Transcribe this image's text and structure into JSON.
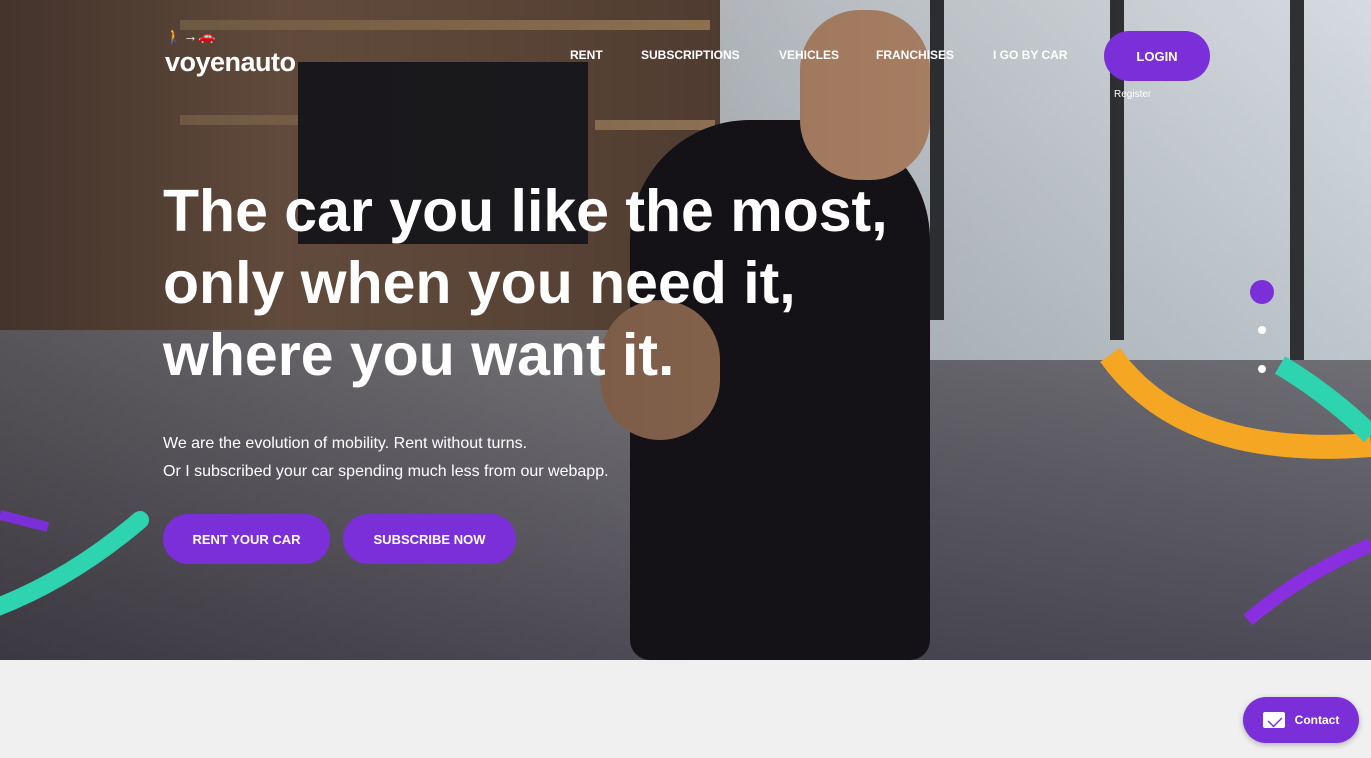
{
  "brand": {
    "logo_mark": "🚶→🚗",
    "name": "voyenauto"
  },
  "nav": {
    "items": [
      "RENT",
      "SUBSCRIPTIONS",
      "VEHICLES",
      "FRANCHISES",
      "I GO BY CAR"
    ],
    "login_label": "LOGIN",
    "register_label": "Register"
  },
  "hero": {
    "headline": [
      "The car you like the most,",
      "only when you need it,",
      "where you want it."
    ],
    "subtext": [
      "We are the evolution of mobility. Rent without turns.",
      "Or I subscribed your car spending much less from our webapp."
    ],
    "cta_rent": "RENT YOUR CAR",
    "cta_subscribe": "SUBSCRIBE NOW"
  },
  "carousel": {
    "active_index": 0,
    "count": 3
  },
  "contact": {
    "label": "Contact",
    "icon": "mail-icon"
  },
  "colors": {
    "accent": "#7a2fd8",
    "teal": "#2ed3b0",
    "orange": "#f5a623"
  }
}
